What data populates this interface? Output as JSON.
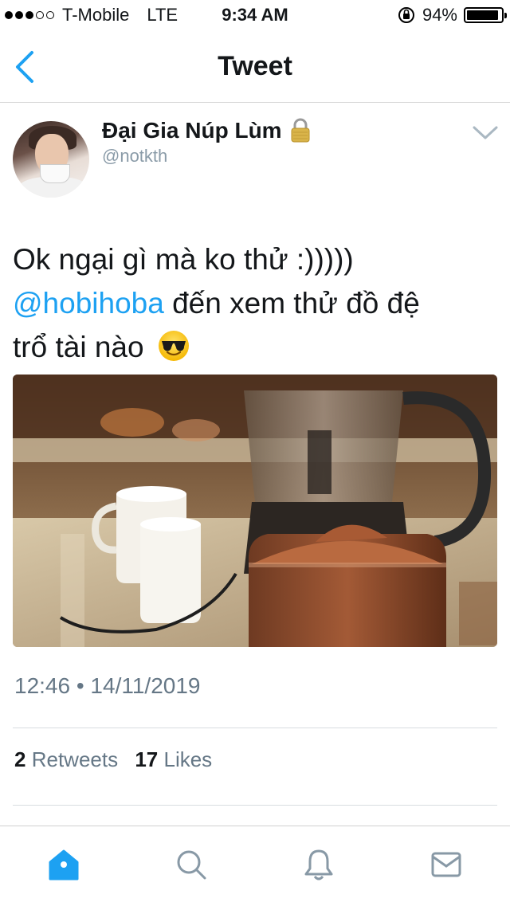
{
  "status_bar": {
    "carrier": "T-Mobile",
    "network": "LTE",
    "time": "9:34 AM",
    "battery": "94%",
    "battery_level": 0.94,
    "signal_bars": 3,
    "signal_max": 5
  },
  "nav": {
    "back_icon": "chevron-left-icon",
    "title": "Tweet",
    "accent_color": "#1da1f2"
  },
  "tweet": {
    "author_name": "Đại Gia Núp Lùm",
    "author_handle": "@notkth",
    "lock_icon": "lock-icon",
    "text_line1": "Ok ngại gì mà ko thử :)))))",
    "mention": "@hobihoba",
    "text_line2_rest": " đến xem thử đồ đệ",
    "text_line3": "trổ tài nào",
    "emoji": "sunglasses-emoji",
    "timestamp": "12:46 • 14/11/2019",
    "retweets_count": "2",
    "retweets_label": "Retweets",
    "likes_count": "17",
    "likes_label": "Likes"
  },
  "tab_bar": {
    "items": [
      "home-icon",
      "search-icon",
      "notifications-icon",
      "messages-icon"
    ],
    "active": "home-icon"
  }
}
